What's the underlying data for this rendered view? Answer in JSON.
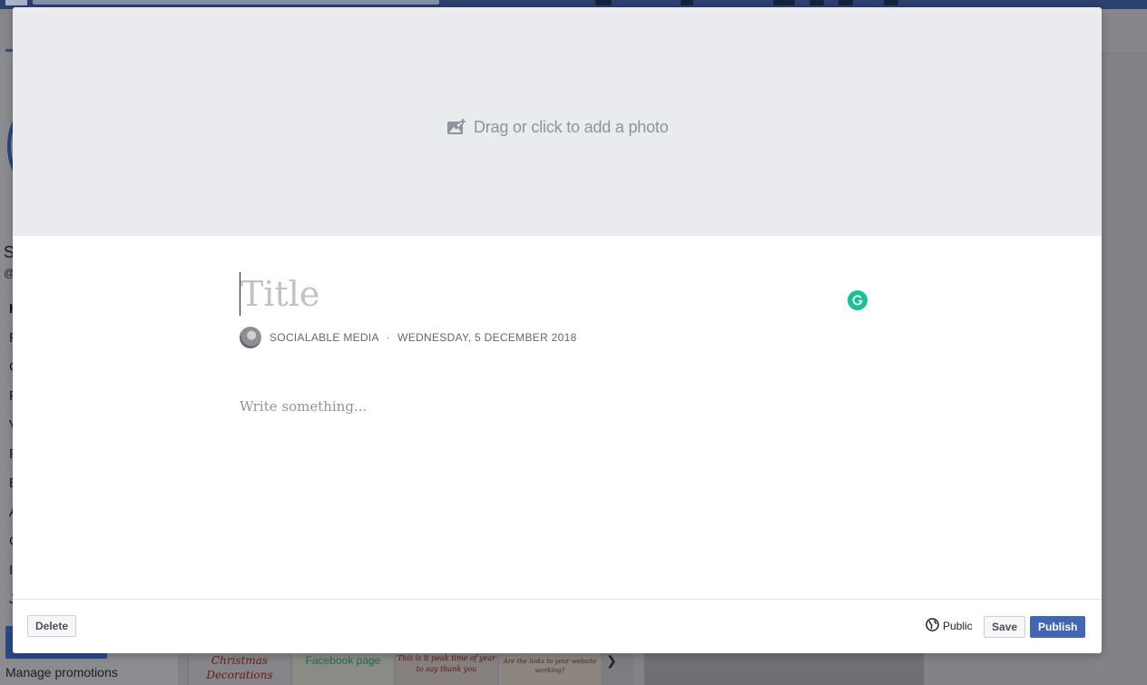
{
  "background": {
    "manage_promotions": "Manage promotions",
    "letters": [
      "S",
      "@",
      "H",
      "P",
      "C",
      "P",
      "V",
      "P",
      "E",
      "A",
      "C",
      "I",
      "J"
    ],
    "thumbs": [
      {
        "text": "Christmas Decorations",
        "color": "#8b1a1a"
      },
      {
        "text": "Facebook page",
        "color": "#2e9a5a"
      },
      {
        "text": "This is it peak time of year to say thank you",
        "color": "#7a1c1c"
      },
      {
        "text": "Are the links to your website working?",
        "color": "#5a3b20"
      }
    ]
  },
  "modal": {
    "photo_prompt": "Drag or click to add a photo",
    "title_placeholder": "Title",
    "author": "SOCIALABLE MEDIA",
    "separator": "·",
    "date": "WEDNESDAY, 5 DECEMBER 2018",
    "body_placeholder": "Write something...",
    "footer": {
      "delete_label": "Delete",
      "privacy_label": "Public",
      "save_label": "Save",
      "publish_label": "Publish"
    }
  },
  "colors": {
    "publish_blue": "#4267b2",
    "grammarly_green": "#15c39a",
    "photo_area_bg": "#e9ebee"
  }
}
